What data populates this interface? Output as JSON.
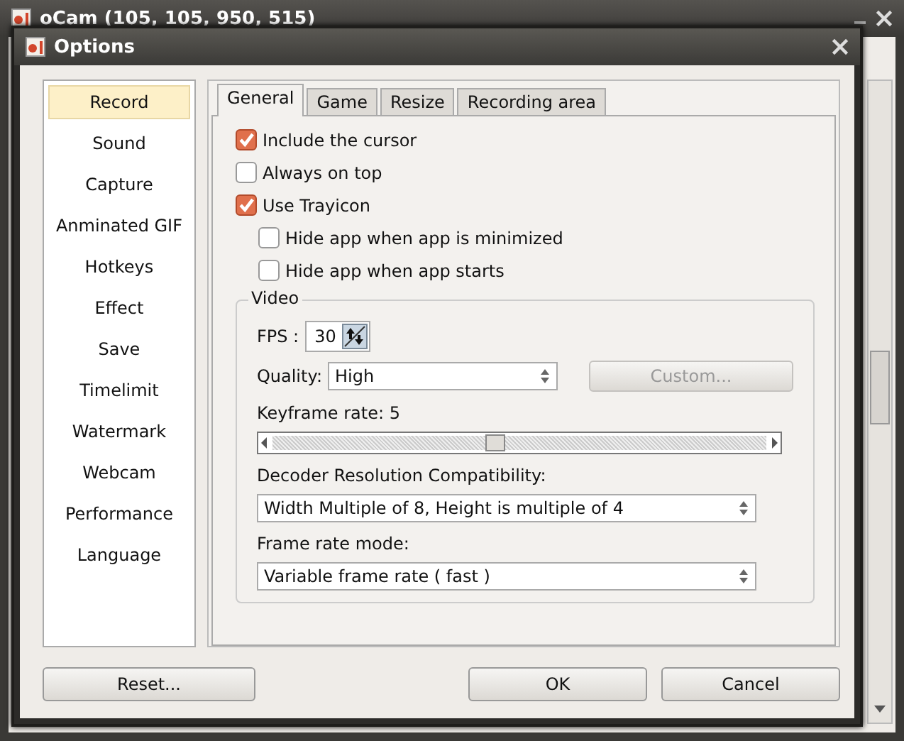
{
  "main_window": {
    "title": "oCam (105, 105, 950, 515)"
  },
  "dialog": {
    "title": "Options"
  },
  "sidebar": {
    "items": [
      {
        "label": "Record",
        "selected": true
      },
      {
        "label": "Sound",
        "selected": false
      },
      {
        "label": "Capture",
        "selected": false
      },
      {
        "label": "Anminated GIF",
        "selected": false
      },
      {
        "label": "Hotkeys",
        "selected": false
      },
      {
        "label": "Effect",
        "selected": false
      },
      {
        "label": "Save",
        "selected": false
      },
      {
        "label": "Timelimit",
        "selected": false
      },
      {
        "label": "Watermark",
        "selected": false
      },
      {
        "label": "Webcam",
        "selected": false
      },
      {
        "label": "Performance",
        "selected": false
      },
      {
        "label": "Language",
        "selected": false
      }
    ]
  },
  "tabs": [
    {
      "label": "General",
      "selected": true
    },
    {
      "label": "Game",
      "selected": false
    },
    {
      "label": "Resize",
      "selected": false
    },
    {
      "label": "Recording area",
      "selected": false
    }
  ],
  "options": [
    {
      "label": "Include the cursor",
      "checked": true,
      "indented": false
    },
    {
      "label": "Always on top",
      "checked": false,
      "indented": false
    },
    {
      "label": "Use Trayicon",
      "checked": true,
      "indented": false
    },
    {
      "label": "Hide app when app is minimized",
      "checked": false,
      "indented": true
    },
    {
      "label": "Hide app when app starts",
      "checked": false,
      "indented": true
    }
  ],
  "video": {
    "title": "Video",
    "fps_label": "FPS :",
    "fps_value": "30",
    "quality_label": "Quality:",
    "quality_value": "High",
    "custom_button": {
      "label": "Custom...",
      "disabled": true
    },
    "keyframe_label": "Keyframe rate: 5",
    "keyframe_slider": {
      "level": 0.45
    },
    "decoder_label": "Decoder Resolution Compatibility:",
    "decoder_value": "Width Multiple of 8, Height is multiple of 4",
    "frame_mode_label": "Frame rate mode:",
    "frame_mode_value": "Variable frame rate ( fast )"
  },
  "buttons": {
    "reset": "Reset...",
    "ok": "OK",
    "cancel": "Cancel"
  }
}
